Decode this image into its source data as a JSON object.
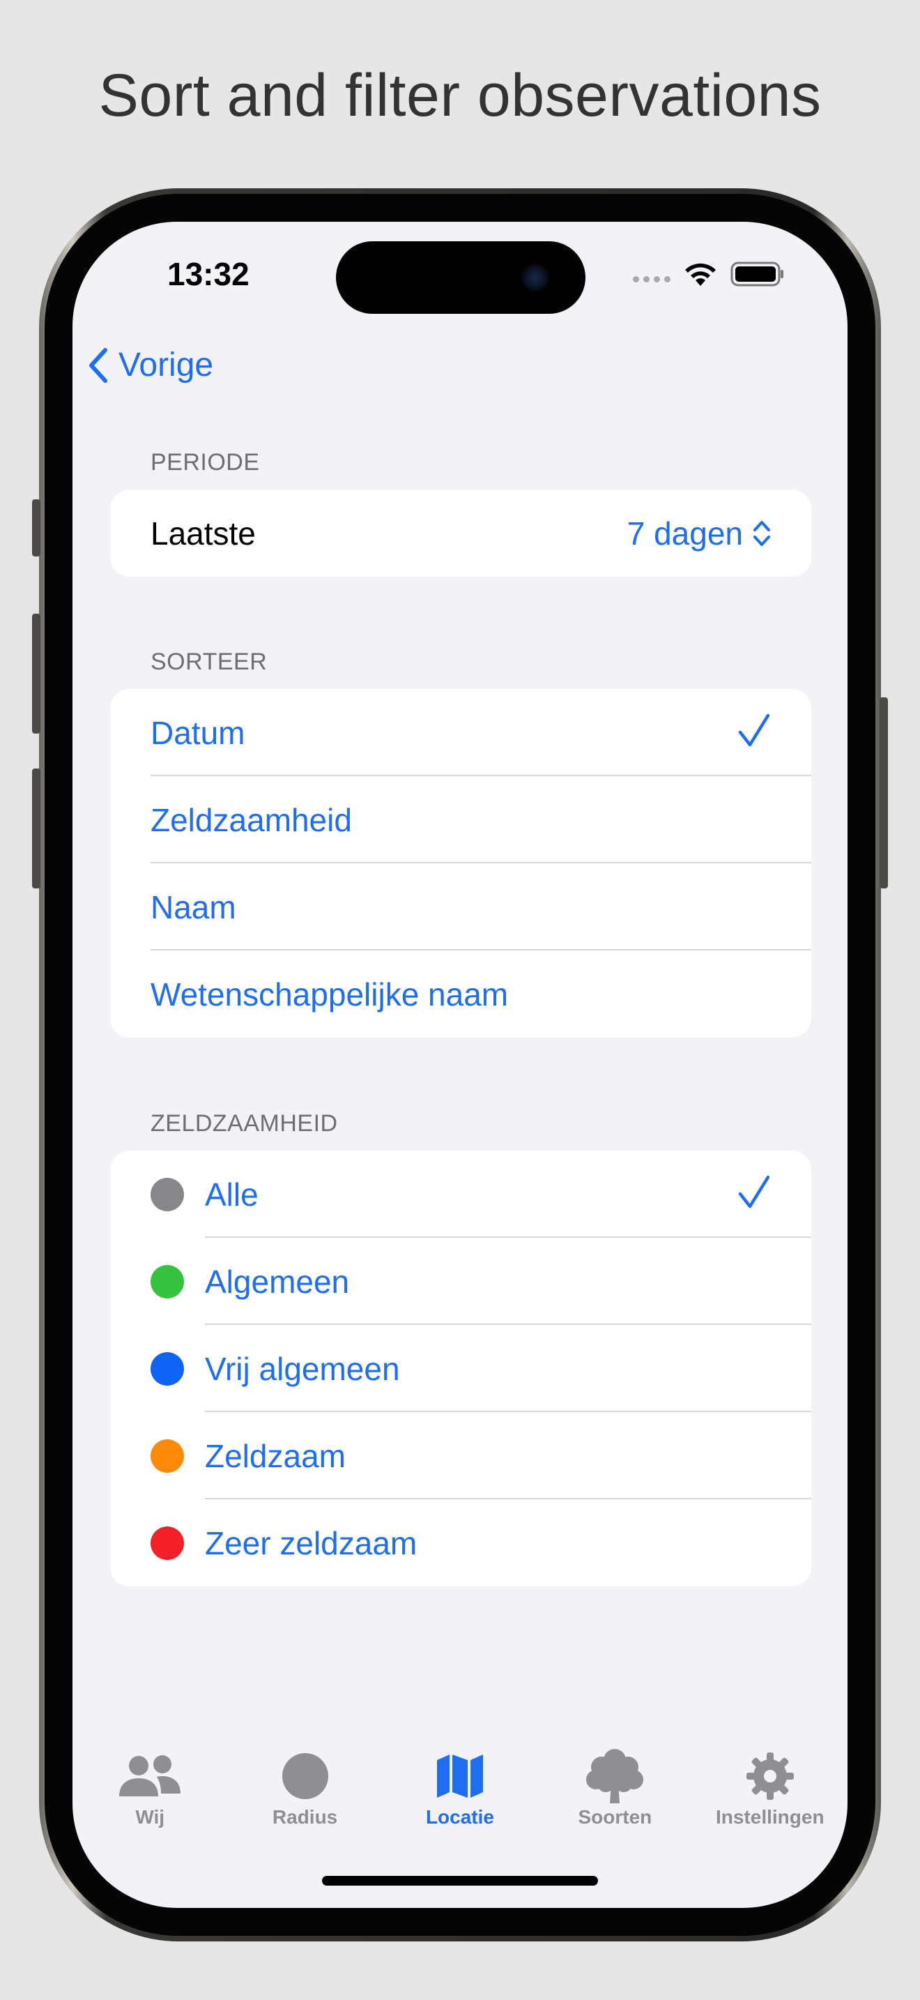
{
  "headline": "Sort and filter observations",
  "status": {
    "time": "13:32"
  },
  "nav": {
    "back_label": "Vorige"
  },
  "period": {
    "header": "PERIODE",
    "label": "Laatste",
    "value": "7 dagen"
  },
  "sort": {
    "header": "SORTEER",
    "items": [
      {
        "label": "Datum",
        "selected": true
      },
      {
        "label": "Zeldzaamheid",
        "selected": false
      },
      {
        "label": "Naam",
        "selected": false
      },
      {
        "label": "Wetenschappelijke naam",
        "selected": false
      }
    ]
  },
  "rarity": {
    "header": "ZELDZAAMHEID",
    "items": [
      {
        "label": "Alle",
        "color": "#86868b",
        "selected": true
      },
      {
        "label": "Algemeen",
        "color": "#34c23f",
        "selected": false
      },
      {
        "label": "Vrij algemeen",
        "color": "#0f63f5",
        "selected": false
      },
      {
        "label": "Zeldzaam",
        "color": "#ff8a0a",
        "selected": false
      },
      {
        "label": "Zeer zeldzaam",
        "color": "#f5212a",
        "selected": false
      }
    ]
  },
  "colors": {
    "accent": "#1f6df0",
    "inactive": "#8e8e93"
  },
  "tabs": [
    {
      "label": "Wij",
      "icon": "people-icon",
      "active": false
    },
    {
      "label": "Radius",
      "icon": "circle-icon",
      "active": false
    },
    {
      "label": "Locatie",
      "icon": "map-icon",
      "active": true
    },
    {
      "label": "Soorten",
      "icon": "tree-icon",
      "active": false
    },
    {
      "label": "Instellingen",
      "icon": "gear-icon",
      "active": false
    }
  ]
}
